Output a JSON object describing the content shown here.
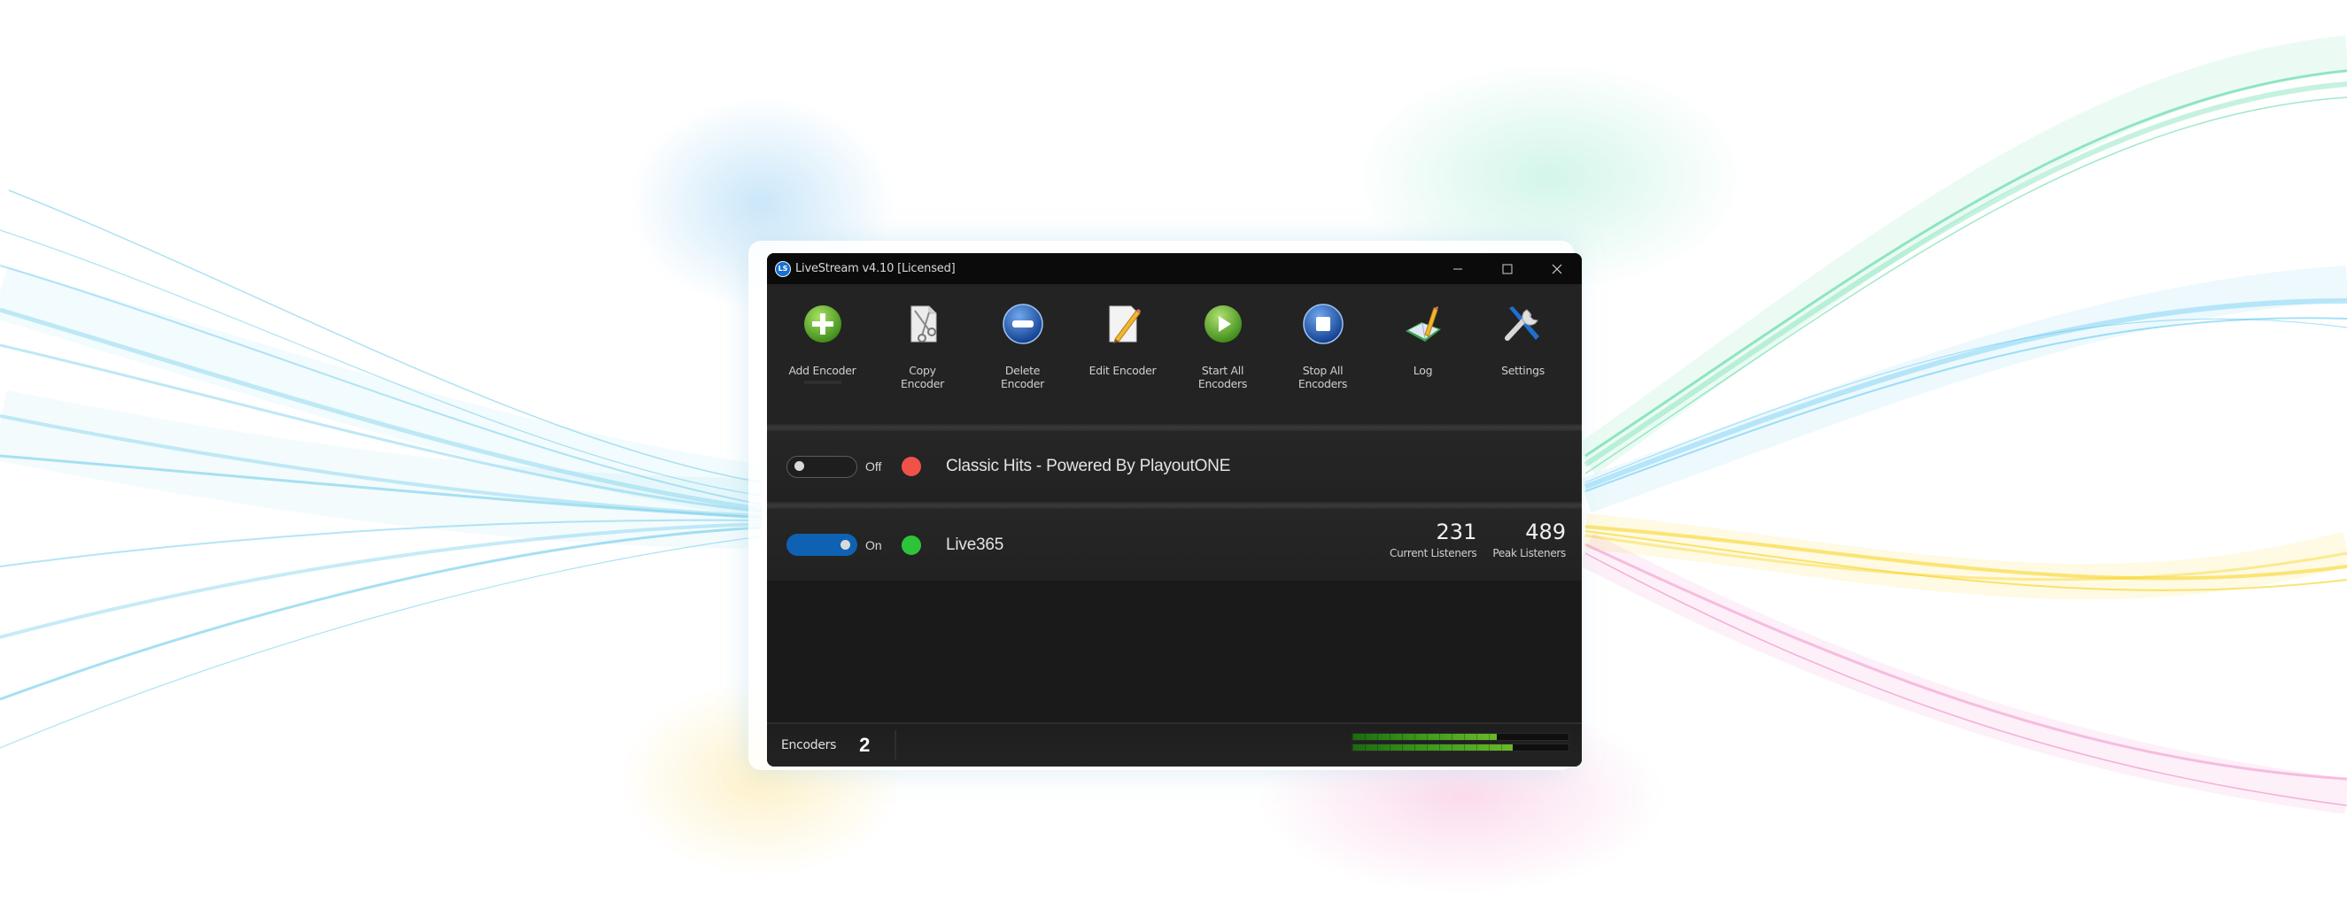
{
  "window": {
    "title": "LiveStream v4.10 [Licensed]",
    "app_icon_text": "LS",
    "controls": [
      "minimize",
      "maximize",
      "close"
    ]
  },
  "toolbar": {
    "items": [
      {
        "id": "add",
        "label": "Add Encoder",
        "icon": "add-icon"
      },
      {
        "id": "copy",
        "label": "Copy\nEncoder",
        "icon": "copy-icon"
      },
      {
        "id": "delete",
        "label": "Delete\nEncoder",
        "icon": "delete-icon"
      },
      {
        "id": "edit",
        "label": "Edit Encoder",
        "icon": "edit-icon"
      },
      {
        "id": "start_all",
        "label": "Start All\nEncoders",
        "icon": "play-icon"
      },
      {
        "id": "stop_all",
        "label": "Stop All\nEncoders",
        "icon": "stop-icon"
      },
      {
        "id": "log",
        "label": "Log",
        "icon": "log-icon"
      },
      {
        "id": "settings",
        "label": "Settings",
        "icon": "settings-icon"
      }
    ]
  },
  "encoders": [
    {
      "name": "Classic Hits - Powered By PlayoutONE",
      "toggle_state": "Off",
      "status_color": "#f0524a"
    },
    {
      "name": "Live365",
      "toggle_state": "On",
      "status_color": "#2ec43a",
      "current_listeners": "231",
      "current_listeners_label": "Current Listeners",
      "peak_listeners": "489",
      "peak_listeners_label": "Peak Listeners"
    }
  ],
  "status_bar": {
    "encoders_label": "Encoders",
    "encoders_count": "2",
    "level_meters": [
      0.67,
      0.74
    ]
  },
  "colors": {
    "accent_blue": "#0f62b3",
    "status_off": "#f0524a",
    "status_on": "#2ec43a"
  }
}
